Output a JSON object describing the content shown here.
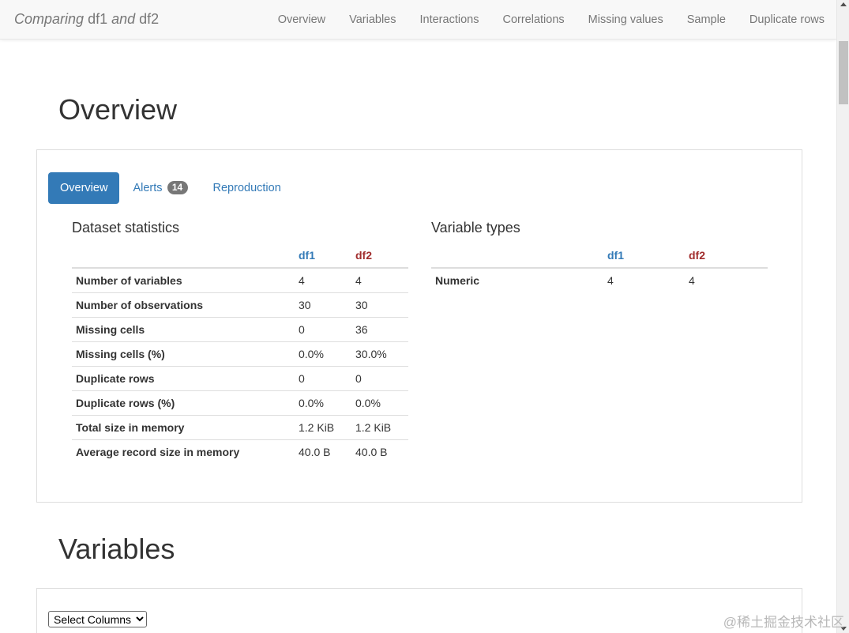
{
  "navbar": {
    "brand_prefix": "Comparing",
    "brand_df1": "df1",
    "brand_and": "and",
    "brand_df2": "df2",
    "links": [
      "Overview",
      "Variables",
      "Interactions",
      "Correlations",
      "Missing values",
      "Sample",
      "Duplicate rows"
    ]
  },
  "overview": {
    "title": "Overview",
    "tabs": {
      "overview": "Overview",
      "alerts": "Alerts",
      "alerts_count": "14",
      "reproduction": "Reproduction"
    },
    "dataset_statistics": {
      "title": "Dataset statistics",
      "col_df1": "df1",
      "col_df2": "df2",
      "rows": [
        {
          "label": "Number of variables",
          "df1": "4",
          "df2": "4"
        },
        {
          "label": "Number of observations",
          "df1": "30",
          "df2": "30"
        },
        {
          "label": "Missing cells",
          "df1": "0",
          "df2": "36"
        },
        {
          "label": "Missing cells (%)",
          "df1": "0.0%",
          "df2": "30.0%"
        },
        {
          "label": "Duplicate rows",
          "df1": "0",
          "df2": "0"
        },
        {
          "label": "Duplicate rows (%)",
          "df1": "0.0%",
          "df2": "0.0%"
        },
        {
          "label": "Total size in memory",
          "df1": "1.2 KiB",
          "df2": "1.2 KiB"
        },
        {
          "label": "Average record size in memory",
          "df1": "40.0 B",
          "df2": "40.0 B"
        }
      ]
    },
    "variable_types": {
      "title": "Variable types",
      "col_df1": "df1",
      "col_df2": "df2",
      "rows": [
        {
          "label": "Numeric",
          "df1": "4",
          "df2": "4"
        }
      ]
    }
  },
  "variables": {
    "title": "Variables",
    "select_value": "Select Columns"
  },
  "watermark": "@稀土掘金技术社区",
  "colors": {
    "accent": "#337ab7",
    "df2": "#a12d2d",
    "navbar_bg": "#f8f8f8"
  }
}
